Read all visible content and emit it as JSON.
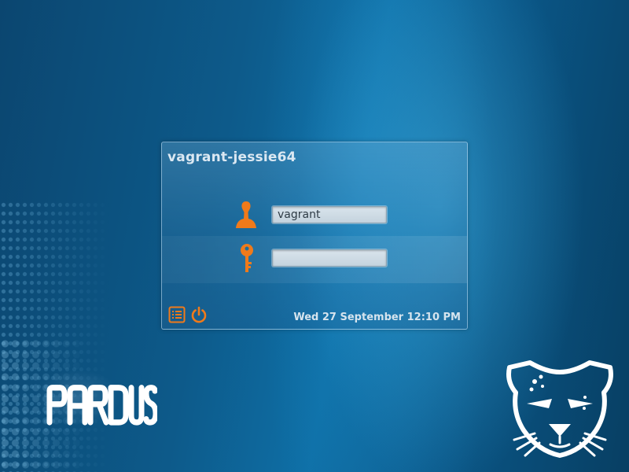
{
  "login": {
    "hostname": "vagrant-jessie64",
    "username_value": "vagrant",
    "password_value": "",
    "datetime": "Wed 27 September 12:10 PM"
  },
  "icons": {
    "user": "user-icon",
    "password": "key-icon",
    "session_menu": "menu-list-icon",
    "power": "power-icon",
    "brand": "leopard-logo-icon"
  },
  "branding": {
    "name": "PARDUS"
  },
  "colors": {
    "accent": "#f07a1a",
    "background_deep": "#0b4670",
    "background_light": "#0e6fa6",
    "panel_text": "#dbe8f2"
  }
}
